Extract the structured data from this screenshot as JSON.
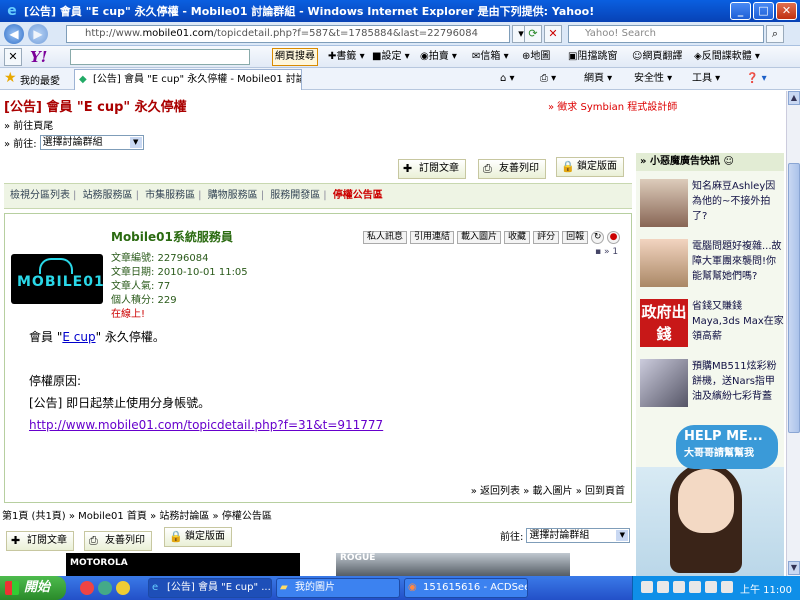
{
  "window": {
    "title": "[公告] 會員 \"E cup\" 永久停權 - Mobile01 討論群組 - Windows Internet Explorer 是由下列提供: Yahoo!",
    "minimize": "_",
    "maximize": "□",
    "close": "✕"
  },
  "address": {
    "prefix": "http://www.",
    "host": "mobile01.com",
    "path": "/topicdetail.php?f=587&t=1785884&last=22796084",
    "search_placeholder": "Yahoo! Search"
  },
  "yahoo_toolbar": {
    "logo": "Y!",
    "search_button": "網頁搜尋",
    "bookmarks": "書籤",
    "settings": "設定",
    "auction": "拍賣",
    "mail": "信箱",
    "map": "地圖",
    "popup_block": "阻擋跳窗",
    "translate": "網頁翻譯",
    "antiphishing": "反間諜軟體"
  },
  "favorites": {
    "label": "我的最愛",
    "tab_title": "[公告] 會員 \"E cup\" 永久停權 - Mobile01 討論群組",
    "page_menu": "網頁",
    "security_menu": "安全性",
    "tools_menu": "工具"
  },
  "page": {
    "title": "[公告] 會員 \"E cup\" 永久停權",
    "ad_link": "» 徵求 Symbian 程式設計師",
    "goto_last": "» 前往頁尾",
    "goto_label": "» 前往:",
    "goto_select": "選擇討論群組",
    "subscribe": "訂閱文章",
    "print": "友善列印",
    "lock": "鎖定版面",
    "categories": [
      "檢視分區列表",
      "站務服務區",
      "市集服務區",
      "購物服務區",
      "服務開發區"
    ],
    "active_category": "停權公告區"
  },
  "post": {
    "author": "Mobile01系統服務員",
    "tools": [
      "私人訊息",
      "引用連結",
      "載入圖片",
      "收藏",
      "評分",
      "回報"
    ],
    "floor": "» 1",
    "logo_text": "MOBILE01",
    "meta": {
      "post_id": "文章編號: 22796084",
      "date": "文章日期: 2010-10-01 11:05",
      "popularity": "文章人氣: 77",
      "points": "個人積分: 229",
      "online": "在線上!"
    },
    "line1_pre": "會員 \"",
    "line1_name": "E cup",
    "line1_post": "\" 永久停權。",
    "reason_label": "停權原因:",
    "reason": "[公告] 即日起禁止使用分身帳號。",
    "url": "http://www.mobile01.com/topicdetail.php?f=31&t=911777",
    "back_row": "» 返回列表 » 載入圖片 » 回到頁首"
  },
  "footer": {
    "page_info": "第1頁 (共1頁) » Mobile01 首頁 » 站務討論區 » 停權公告區",
    "goto_label": "前往:",
    "goto_select": "選擇討論群組",
    "banner1": "MOTOROLA",
    "banner2": "ROGUE"
  },
  "sidebar": {
    "heading": "» 小惡魔廣告快訊",
    "ads": [
      {
        "text": "知名麻豆Ashley因為他的~不接外拍了?"
      },
      {
        "text": "電腦問題好複雜...故障大軍團來襲問!你能幫幫她們嗎?"
      },
      {
        "text": "省錢又賺錢Maya,3ds Max在家領高薪"
      },
      {
        "text": "預購MB511炫彩粉餅機，送Nars指甲油及繽紛七彩背蓋"
      }
    ],
    "gov_text": "政府出錢",
    "help_title": "HELP ME...",
    "help_sub": "大哥哥請幫幫我"
  },
  "taskbar": {
    "start": "開始",
    "items": [
      "[公告] 會員 \"E cup\" ...",
      "我的圖片",
      "151615616 - ACDSee ..."
    ],
    "clock": "上午 11:00"
  }
}
